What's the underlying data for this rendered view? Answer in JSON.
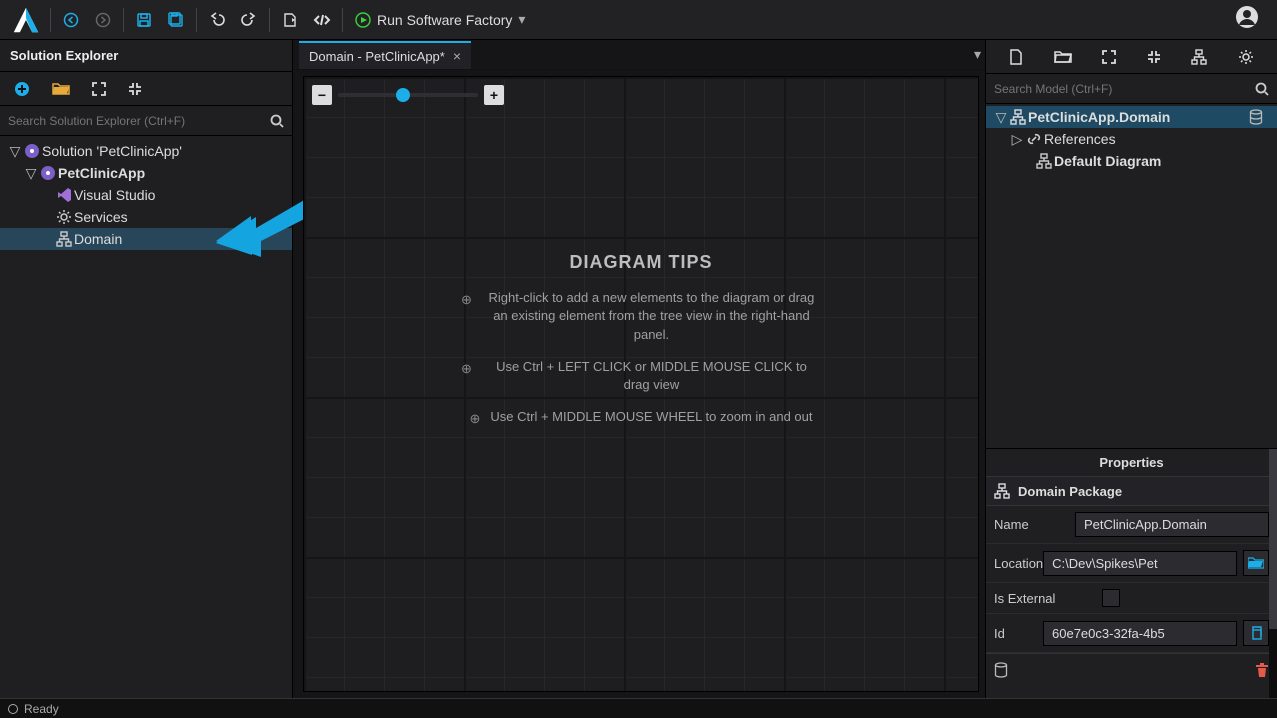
{
  "topbar": {
    "run_label": "Run Software Factory"
  },
  "left": {
    "title": "Solution Explorer",
    "search_placeholder": "Search Solution Explorer (Ctrl+F)",
    "tree": {
      "solution": "Solution 'PetClinicApp'",
      "project": "PetClinicApp",
      "items": [
        "Visual Studio",
        "Services",
        "Domain"
      ]
    }
  },
  "center": {
    "tab_label": "Domain - PetClinicApp*",
    "tips_heading": "DIAGRAM TIPS",
    "tips": [
      "Right-click to add a new elements to the diagram or drag an existing element from the tree view in the right-hand panel.",
      "Use Ctrl + LEFT CLICK or MIDDLE MOUSE CLICK to drag view",
      "Use Ctrl + MIDDLE MOUSE WHEEL to zoom in and out"
    ]
  },
  "right": {
    "search_placeholder": "Search Model (Ctrl+F)",
    "tree": {
      "root": "PetClinicApp.Domain",
      "references": "References",
      "diagram": "Default Diagram"
    },
    "properties": {
      "title": "Properties",
      "header": "Domain Package",
      "rows": {
        "name": {
          "label": "Name",
          "value": "PetClinicApp.Domain"
        },
        "location": {
          "label": "Location",
          "value": "C:\\Dev\\Spikes\\Pet"
        },
        "is_external": {
          "label": "Is External"
        },
        "id": {
          "label": "Id",
          "value": "60e7e0c3-32fa-4b5"
        }
      }
    }
  },
  "statusbar": {
    "text": "Ready"
  }
}
